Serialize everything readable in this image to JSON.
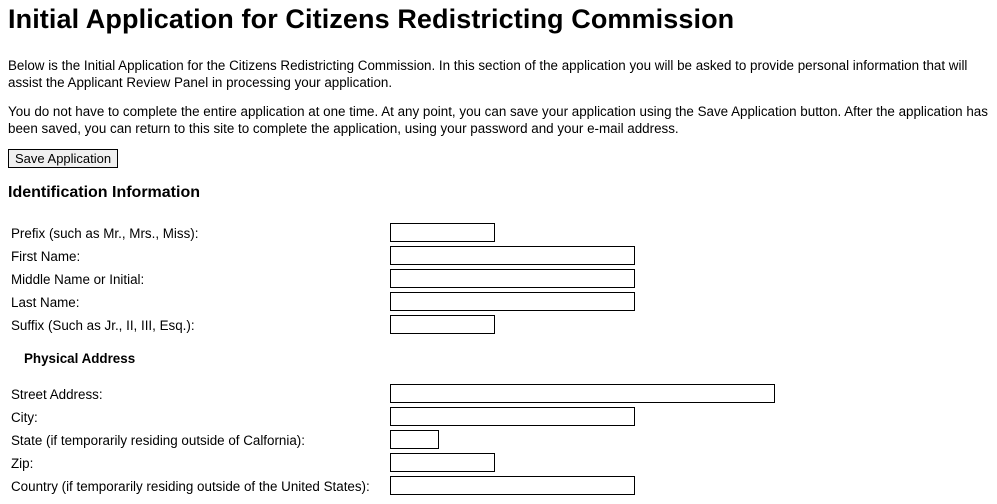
{
  "page": {
    "title": "Initial Application for Citizens Redistricting Commission",
    "intro_1": "Below is the Initial Application for the Citizens Redistricting Commission. In this section of the application you will be asked to provide personal information that will assist the Applicant Review Panel in processing your application.",
    "intro_2": "You do not have to complete the entire application at one time. At any point, you can save your application using the Save Application button. After the application has been saved, you can return to this site to complete the application, using your password and your e-mail address."
  },
  "toolbar": {
    "save_label": "Save Application"
  },
  "identification": {
    "heading": "Identification Information",
    "prefix_label": "Prefix (such as Mr., Mrs., Miss):",
    "prefix_value": "",
    "first_name_label": "First Name:",
    "first_name_value": "",
    "middle_name_label": "Middle Name or Initial:",
    "middle_name_value": "",
    "last_name_label": "Last Name:",
    "last_name_value": "",
    "suffix_label": "Suffix (Such as Jr., II, III, Esq.):",
    "suffix_value": ""
  },
  "physical_address": {
    "heading": "Physical Address",
    "street_label": "Street Address:",
    "street_value": "",
    "city_label": "City:",
    "city_value": "",
    "state_label": "State (if temporarily residing outside of Calfornia):",
    "state_value": "",
    "zip_label": "Zip:",
    "zip_value": "",
    "country_label": "Country (if temporarily residing outside of the United States):",
    "country_value": ""
  }
}
